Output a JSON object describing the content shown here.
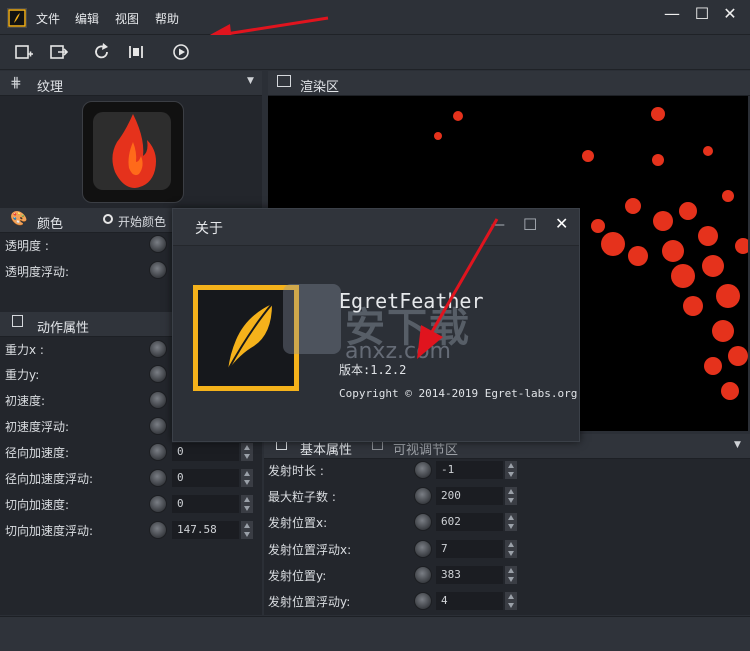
{
  "menu": [
    "文件",
    "编辑",
    "视图",
    "帮助"
  ],
  "window_buttons": {
    "minimize": "—",
    "maximize": "☐",
    "close": "✕"
  },
  "texture_panel": {
    "title": "纹理"
  },
  "render_panel": {
    "title": "渲染区"
  },
  "color_panel": {
    "title": "颜色",
    "radio_label": "开始颜色",
    "rows": [
      "透明度 :",
      "透明度浮动:"
    ]
  },
  "motion_panel": {
    "title": "动作属性",
    "rows": [
      {
        "label": "重力x :",
        "value": ""
      },
      {
        "label": "重力y:",
        "value": ""
      },
      {
        "label": "初速度:",
        "value": ""
      },
      {
        "label": "初速度浮动:",
        "value": ""
      },
      {
        "label": "径向加速度:",
        "value": "0"
      },
      {
        "label": "径向加速度浮动:",
        "value": "0"
      },
      {
        "label": "切向加速度:",
        "value": "0"
      },
      {
        "label": "切向加速度浮动:",
        "value": "147.58"
      }
    ]
  },
  "basic_panel": {
    "tabs": [
      "基本属性",
      "可视调节区"
    ],
    "rows": [
      {
        "label": "发射时长 :",
        "value": "-1"
      },
      {
        "label": "最大粒子数 :",
        "value": "200"
      },
      {
        "label": "发射位置x:",
        "value": "602"
      },
      {
        "label": "发射位置浮动x:",
        "value": "7"
      },
      {
        "label": "发射位置y:",
        "value": "383"
      },
      {
        "label": "发射位置浮动y:",
        "value": "4"
      }
    ]
  },
  "about_dialog": {
    "title": "关于",
    "app_name": "EgretFeather",
    "version": "版本:1.2.2",
    "copyright": "Copyright © 2014-2019 Egret-labs.org",
    "watermark_text": "安下载",
    "watermark_url": "anxz.com"
  },
  "colors": {
    "accent": "#f5b21b",
    "arrow": "#e0141e",
    "flame": "#e5321c",
    "background": "#2b2f36"
  }
}
